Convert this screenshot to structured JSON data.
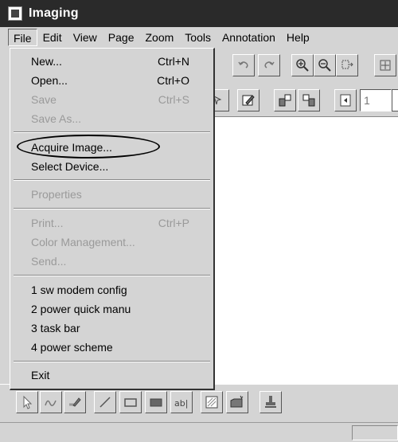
{
  "window": {
    "title": "Imaging",
    "app_icon": "imaging-app-icon"
  },
  "menubar": [
    "File",
    "Edit",
    "View",
    "Page",
    "Zoom",
    "Tools",
    "Annotation",
    "Help"
  ],
  "file_menu": {
    "new": {
      "label": "New...",
      "shortcut": "Ctrl+N"
    },
    "open": {
      "label": "Open...",
      "shortcut": "Ctrl+O"
    },
    "save": {
      "label": "Save",
      "shortcut": "Ctrl+S"
    },
    "save_as": {
      "label": "Save As..."
    },
    "acquire_image": {
      "label": "Acquire Image..."
    },
    "select_device": {
      "label": "Select Device..."
    },
    "properties": {
      "label": "Properties"
    },
    "print": {
      "label": "Print...",
      "shortcut": "Ctrl+P"
    },
    "color_management": {
      "label": "Color Management..."
    },
    "send": {
      "label": "Send..."
    },
    "recent": [
      "1 sw modem config",
      "2 power quick manu",
      "3 task bar",
      "4 power scheme"
    ],
    "exit": {
      "label": "Exit"
    }
  },
  "toolbar": {
    "page_number": "1"
  },
  "annotation_tools": [
    "select-pointer-icon",
    "freehand-line-icon",
    "highlighter-icon",
    "straight-line-icon",
    "hollow-rectangle-icon",
    "filled-rectangle-icon",
    "text-icon",
    "attach-note-icon",
    "text-from-file-icon",
    "rubber-stamp-icon"
  ],
  "colors": {
    "title_bar": "#2a2a2a",
    "chrome": "#d4d4d4",
    "disabled_text": "#9a9a9a"
  }
}
